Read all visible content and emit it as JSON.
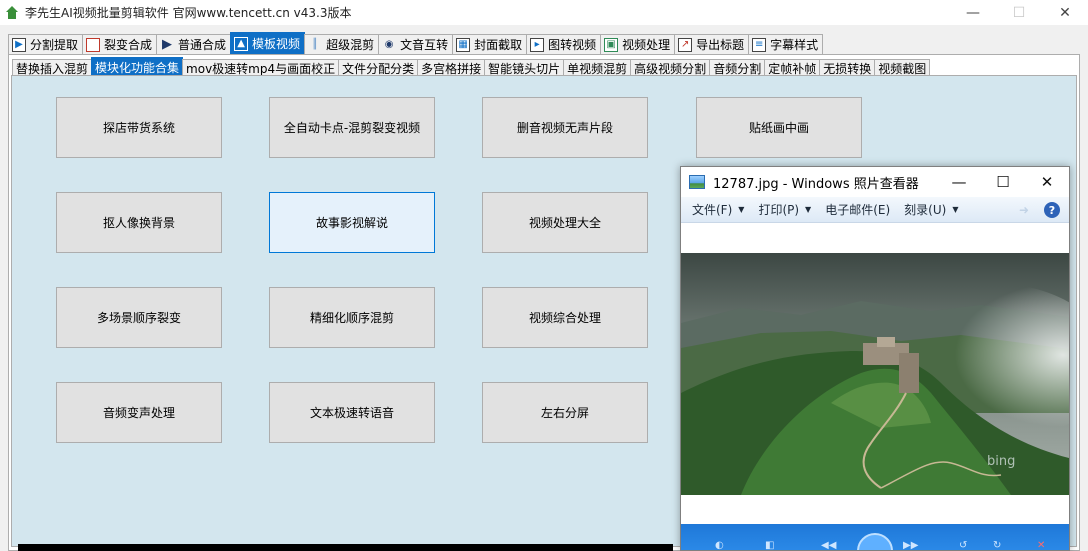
{
  "window": {
    "title": "李先生AI视频批量剪辑软件    官网www.tencett.cn    v43.3版本",
    "min": "—",
    "max": "☐",
    "close": "✕"
  },
  "main_tabs": [
    {
      "label": "分割提取",
      "icon": "play-square-icon"
    },
    {
      "label": "裂变合成",
      "icon": "square-icon"
    },
    {
      "label": "普通合成",
      "icon": "play-icon"
    },
    {
      "label": "模板视频",
      "icon": "template-icon"
    },
    {
      "label": "超级混剪",
      "icon": "waveform-icon"
    },
    {
      "label": "文音互转",
      "icon": "microphone-icon"
    },
    {
      "label": "封面截取",
      "icon": "image-icon"
    },
    {
      "label": "图转视频",
      "icon": "image-video-icon"
    },
    {
      "label": "视频处理",
      "icon": "video-process-icon"
    },
    {
      "label": "导出标题",
      "icon": "export-icon"
    },
    {
      "label": "字幕样式",
      "icon": "subtitle-icon"
    }
  ],
  "sub_tabs": [
    "替换插入混剪",
    "模块化功能合集",
    "mov极速转mp4与画面校正",
    "文件分配分类",
    "多宫格拼接",
    "智能镜头切片",
    "单视频混剪",
    "高级视频分割",
    "音频分割",
    "定帧补帧",
    "无损转换",
    "视频截图"
  ],
  "features": [
    "探店带货系统",
    "全自动卡点-混剪裂变视频",
    "删音视频无声片段",
    "贴纸画中画",
    "抠人像换背景",
    "故事影视解说",
    "视频处理大全",
    "多场景顺序裂变",
    "精细化顺序混剪",
    "视频综合处理",
    "音频变声处理",
    "文本极速转语音",
    "左右分屏"
  ],
  "viewer": {
    "title": "12787.jpg - Windows 照片查看器",
    "min": "—",
    "max": "☐",
    "close": "✕",
    "menu": [
      "文件(F)",
      "打印(P)",
      "电子邮件(E)",
      "刻录(U)"
    ],
    "help": "?",
    "watermark": "bing"
  }
}
